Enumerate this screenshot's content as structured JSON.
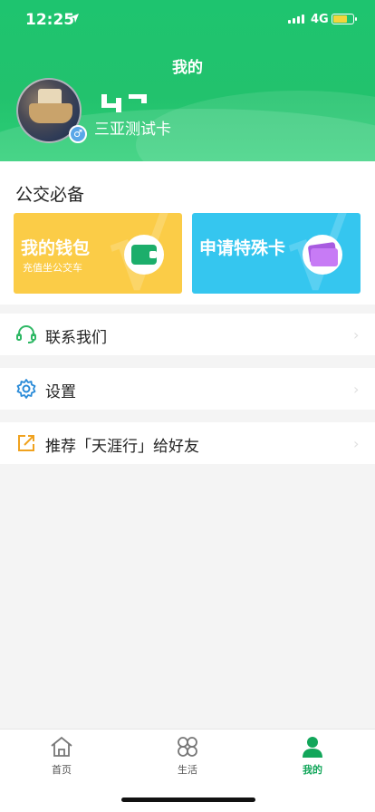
{
  "status_bar": {
    "time": "12:25",
    "network": "4G",
    "battery_level": 0.75
  },
  "header": {
    "title": "我的",
    "card_name": "三亚测试卡"
  },
  "bus_section": {
    "title": "公交必备",
    "tiles": [
      {
        "title": "我的钱包",
        "subtitle": "充值坐公交车",
        "icon": "wallet-icon",
        "color": "#fbcc47"
      },
      {
        "title": "申请特殊卡",
        "subtitle": "",
        "icon": "cards-icon",
        "color": "#35c6ef"
      }
    ]
  },
  "menu": [
    {
      "label": "联系我们",
      "icon": "headset-icon"
    },
    {
      "label": "设置",
      "icon": "gear-icon"
    },
    {
      "label": "推荐「天涯行」给好友",
      "icon": "share-icon"
    }
  ],
  "tabbar": {
    "items": [
      {
        "label": "首页",
        "icon": "home-icon"
      },
      {
        "label": "生活",
        "icon": "clover-icon"
      },
      {
        "label": "我的",
        "icon": "person-icon",
        "active": true
      }
    ],
    "accent": "#12a65a"
  },
  "colors": {
    "header_green": "#1ec46f",
    "wallet_yellow": "#fbcc47",
    "special_blue": "#35c6ef"
  }
}
